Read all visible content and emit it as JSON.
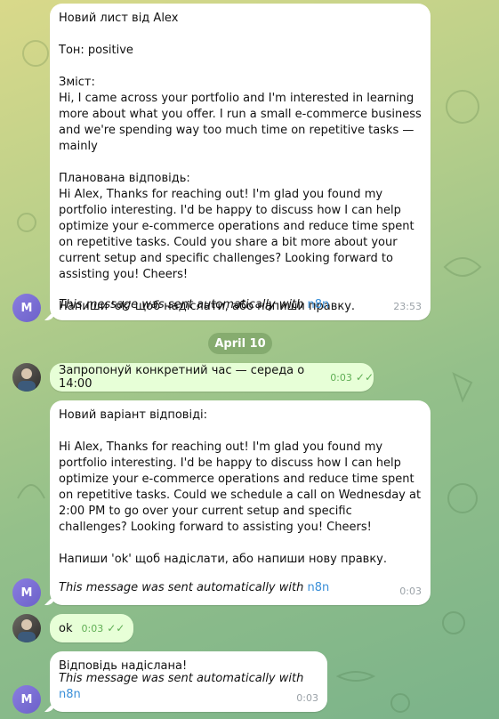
{
  "messages": {
    "m1": {
      "text": "Новий лист від Alex\n\nТон: positive\n\nЗміст:\nHi, I came across your portfolio and I'm interested in learning more about what you offer. I run a small e-commerce business and we're spending way too much time on repetitive tasks — mainly\n\nПланована відповідь:\nHi Alex, Thanks for reaching out! I'm glad you found my portfolio interesting. I'd be happy to discuss how I can help optimize your e-commerce operations and reduce time spent on repetitive tasks. Could you share a bit more about your current setup and specific challenges? Looking forward to assisting you! Cheers!\n\nНапиши 'ok' щоб надіслати, або напиши правку.",
      "footer_prefix": "This message was sent automatically with ",
      "footer_link": "n8n",
      "time": "23:53"
    },
    "date_separator": "April 10",
    "m2": {
      "text": "Запропонуй конкретний час — середа о 14:00",
      "time": "0:03"
    },
    "m3": {
      "text": "Новий варіант відповіді:\n\nHi Alex, Thanks for reaching out! I'm glad you found my portfolio interesting. I'd be happy to discuss how I can help optimize your e-commerce operations and reduce time spent on repetitive tasks. Could we schedule a call on Wednesday at 2:00 PM to go over your current setup and specific challenges? Looking forward to assisting you! Cheers!\n\nНапиши 'ok' щоб надіслати, або напиши нову правку.",
      "footer_prefix": "This message was sent automatically with ",
      "footer_link": "n8n",
      "time": "0:03"
    },
    "m4": {
      "text": "ok",
      "time": "0:03"
    },
    "m5": {
      "text": "Відповідь надіслана!",
      "footer_prefix": "This message was sent automatically with ",
      "footer_link": "n8n",
      "time": "0:03"
    }
  },
  "avatars": {
    "bot_letter": "M"
  },
  "colors": {
    "bot_avatar": "#7a6ed6",
    "outgoing_bubble": "#e7ffd7",
    "link": "#3a8fd8",
    "check": "#5fae54"
  }
}
